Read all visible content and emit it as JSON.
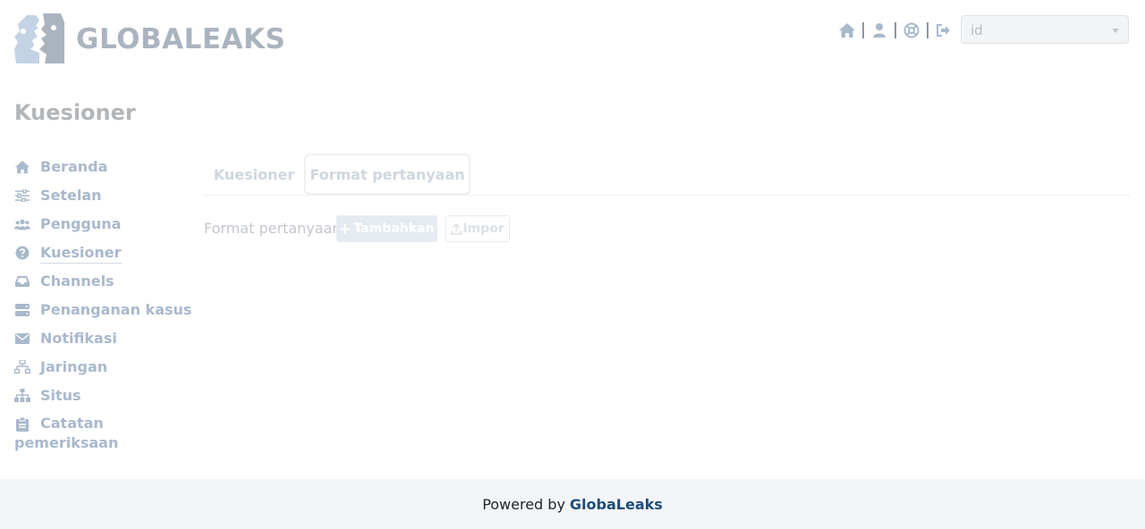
{
  "header": {
    "logo_text": "GLOBALEAKS",
    "icons": [
      "home-icon",
      "user-icon",
      "lifebuoy-icon",
      "logout-icon"
    ],
    "language": {
      "value": "id"
    }
  },
  "page": {
    "title": "Kuesioner"
  },
  "sidebar": {
    "items": [
      {
        "label": "Beranda",
        "icon": "home-icon"
      },
      {
        "label": "Setelan",
        "icon": "sliders-icon"
      },
      {
        "label": "Pengguna",
        "icon": "users-icon"
      },
      {
        "label": "Kuesioner",
        "icon": "question-circle-icon",
        "active": true
      },
      {
        "label": "Channels",
        "icon": "inbox-icon"
      },
      {
        "label": "Penanganan kasus",
        "icon": "server-icon"
      },
      {
        "label": "Notifikasi",
        "icon": "envelope-icon"
      },
      {
        "label": "Jaringan",
        "icon": "network-icon"
      },
      {
        "label": "Situs",
        "icon": "sitemap-icon"
      },
      {
        "label": "Catatan",
        "label_line2": "pemeriksaan",
        "icon": "clipboard-icon"
      }
    ]
  },
  "tabs": [
    {
      "label": "Kuesioner"
    },
    {
      "label": "Format pertanyaan",
      "active": true
    }
  ],
  "toolbar": {
    "label": "Format pertanyaan",
    "add_label": "Tambahkan",
    "import_label": "Impor"
  },
  "footer": {
    "prefix": "Powered by",
    "brand": "GlobaLeaks"
  },
  "colors": {
    "icon": "#a9b9cc",
    "brand": "#1e4c7a",
    "footer_bg": "#f4f5f9"
  }
}
